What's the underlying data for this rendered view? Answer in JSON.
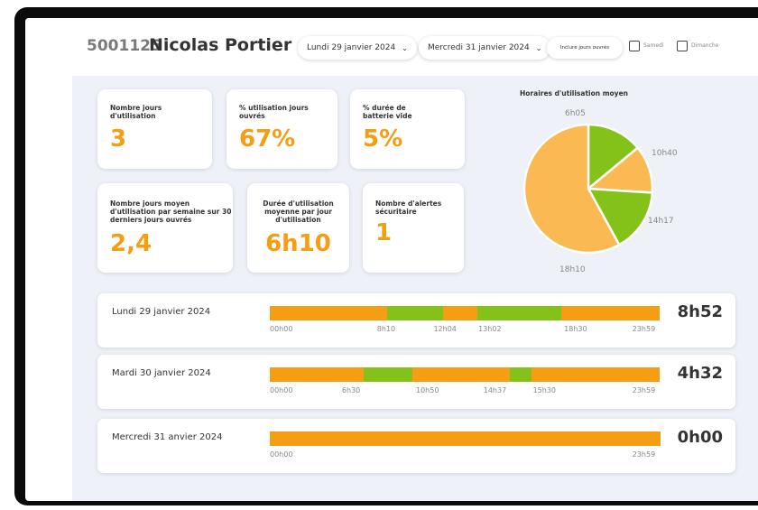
{
  "colors": {
    "orange": "#f59e14",
    "green": "#84c21a",
    "pie_orange": "#fbb953"
  },
  "header": {
    "id": "5001125",
    "name": "Nicolas Portier",
    "start_date": "Lundi 29 janvier 2024",
    "end_date": "Mercredi 31 janvier 2024",
    "include_label": "Inclure jours ouvrés",
    "saturday_label": "Samedi",
    "sunday_label": "Dimanche",
    "chevron_icon": "chevron-down-icon"
  },
  "stats": [
    {
      "label": "Nombre jours d'utilisation",
      "value": "3"
    },
    {
      "label": "% utilisation jours ouvrés",
      "value": "67%"
    },
    {
      "label": "% durée de batterie vide",
      "value": "5%"
    },
    {
      "label": "Nombre jours moyen d'utilisation par semaine sur 30 derniers jours ouvrés",
      "value": "2,4"
    },
    {
      "label": "Durée d'utilisation moyenne par jour d'utilisation",
      "value": "6h10"
    },
    {
      "label": "Nombre d'alertes sécuritaire",
      "value": "1"
    }
  ],
  "chart_data": {
    "type": "pie",
    "title": "Horaires d'utilisation moyen",
    "labels": [
      "6h05",
      "10h40",
      "14h17",
      "18h10"
    ],
    "values": [
      14,
      12,
      16,
      58
    ],
    "colors": [
      "#84c21a",
      "#fbb953",
      "#84c21a",
      "#fbb953"
    ]
  },
  "days": [
    {
      "label": "Lundi 29 janvier 2024",
      "total": "8h52",
      "segments": [
        {
          "from": 0,
          "to": 0.302,
          "color": "orange"
        },
        {
          "from": 0.302,
          "to": 0.445,
          "color": "green"
        },
        {
          "from": 0.445,
          "to": 0.533,
          "color": "orange"
        },
        {
          "from": 0.533,
          "to": 0.748,
          "color": "green"
        },
        {
          "from": 0.748,
          "to": 1,
          "color": "orange"
        }
      ],
      "ticks": [
        {
          "label": "00h00",
          "pos": 0
        },
        {
          "label": "8h10",
          "pos": 0.275
        },
        {
          "label": "12h04",
          "pos": 0.42
        },
        {
          "label": "13h02",
          "pos": 0.535
        },
        {
          "label": "18h30",
          "pos": 0.755
        },
        {
          "label": "23h59",
          "pos": 0.93
        }
      ]
    },
    {
      "label": "Mardi 30 janvier 2024",
      "total": "4h32",
      "segments": [
        {
          "from": 0,
          "to": 0.24,
          "color": "orange"
        },
        {
          "from": 0.24,
          "to": 0.365,
          "color": "green"
        },
        {
          "from": 0.365,
          "to": 0.615,
          "color": "orange"
        },
        {
          "from": 0.615,
          "to": 0.672,
          "color": "green"
        },
        {
          "from": 0.672,
          "to": 1,
          "color": "orange"
        }
      ],
      "ticks": [
        {
          "label": "00h00",
          "pos": 0
        },
        {
          "label": "6h30",
          "pos": 0.185
        },
        {
          "label": "10h50",
          "pos": 0.375
        },
        {
          "label": "14h37",
          "pos": 0.548
        },
        {
          "label": "15h30",
          "pos": 0.675
        },
        {
          "label": "23h59",
          "pos": 0.93
        }
      ]
    },
    {
      "label": "Mercredi 31 anvier 2024",
      "total": "0h00",
      "segments": [
        {
          "from": 0,
          "to": 1,
          "color": "orange"
        }
      ],
      "ticks": [
        {
          "label": "00h00",
          "pos": 0
        },
        {
          "label": "23h59",
          "pos": 0.93
        }
      ]
    }
  ]
}
